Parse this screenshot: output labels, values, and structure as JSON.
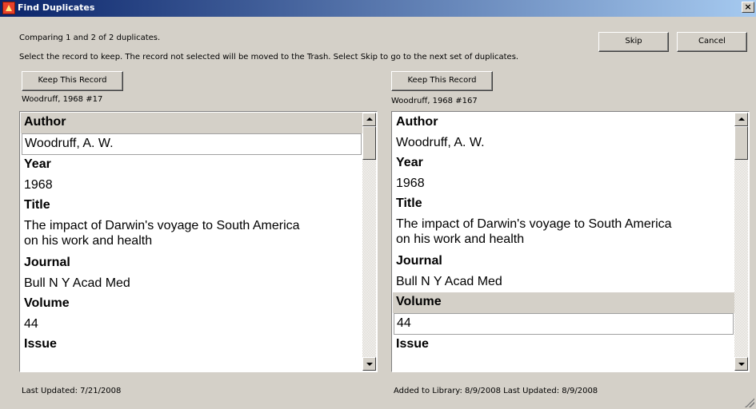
{
  "window": {
    "title": "Find Duplicates",
    "close_glyph": "×"
  },
  "info": {
    "comparing": "Comparing 1 and 2 of 2 duplicates.",
    "instructions": "Select the record to keep. The record not selected will be moved to the Trash. Select Skip to go to the next set of duplicates."
  },
  "buttons": {
    "skip": "Skip",
    "cancel": "Cancel"
  },
  "left": {
    "keep_label": "Keep This Record",
    "record_label": "Woodruff, 1968 #17",
    "fields": {
      "author_label": "Author",
      "author": "Woodruff, A. W.",
      "year_label": "Year",
      "year": "1968",
      "title_label": "Title",
      "title_line1": "The impact of Darwin's voyage to South America",
      "title_line2": "on his work and health",
      "journal_label": "Journal",
      "journal": "Bull N Y Acad Med",
      "volume_label": "Volume",
      "volume": "44",
      "issue_label": "Issue"
    },
    "footer": "Last Updated: 7/21/2008"
  },
  "right": {
    "keep_label": "Keep This Record",
    "record_label": "Woodruff, 1968 #167",
    "fields": {
      "author_label": "Author",
      "author": "Woodruff, A. W.",
      "year_label": "Year",
      "year": "1968",
      "title_label": "Title",
      "title_line1": "The impact of Darwin's voyage to South America",
      "title_line2": "on his work and health",
      "journal_label": "Journal",
      "journal": "Bull N Y Acad Med",
      "volume_label": "Volume",
      "volume": "44",
      "issue_label": "Issue"
    },
    "footer": "Added to Library: 8/9/2008   Last Updated: 8/9/2008"
  }
}
